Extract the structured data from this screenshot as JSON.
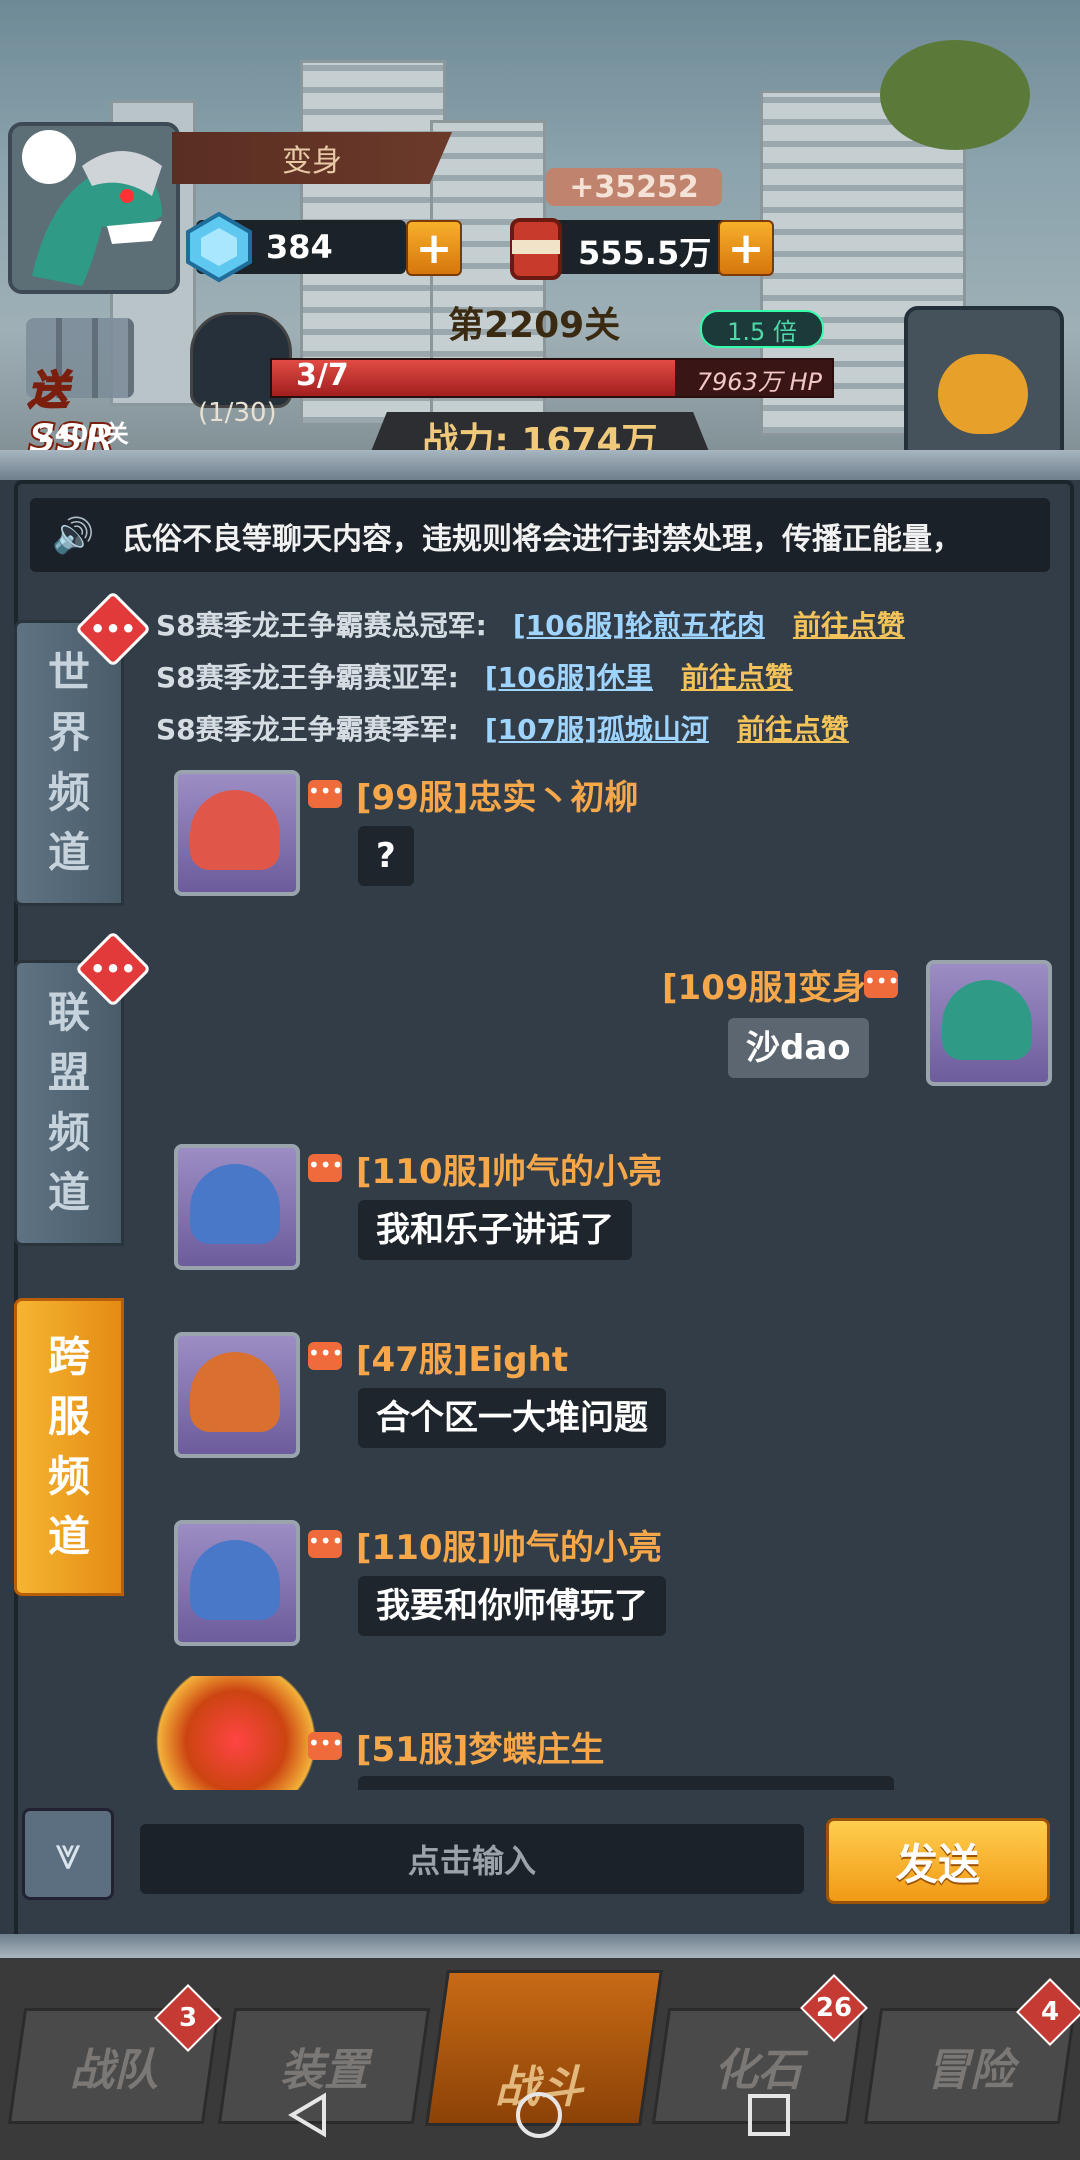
{
  "hud": {
    "player_name": "变身",
    "gems": "384",
    "coins": "555.5万",
    "coin_gain": "+35252",
    "stage": "第2209关",
    "speed": "1.5 倍",
    "boss_progress": "3/7",
    "boss_hp": "7963万 HP",
    "boss_hp_fraction": 0.72,
    "wave": "(1/30)",
    "power": "战力: 1674万",
    "ssr_label": "送SSR",
    "ssr_stage": "2400关"
  },
  "notice": {
    "text": "氐俗不良等聊天内容，违规则将会进行封禁处理，传播正能量，"
  },
  "tabs": [
    {
      "label": [
        "世",
        "界",
        "频",
        "道"
      ],
      "active": false
    },
    {
      "label": [
        "联",
        "盟",
        "频",
        "道"
      ],
      "active": false
    },
    {
      "label": [
        "跨",
        "服",
        "频",
        "道"
      ],
      "active": true
    }
  ],
  "announcements": [
    {
      "title": "S8赛季龙王争霸赛总冠军:",
      "server": "[106服]轮煎五花肉",
      "action": "前往点赞"
    },
    {
      "title": "S8赛季龙王争霸赛亚军:",
      "server": "[106服]休里",
      "action": "前往点赞"
    },
    {
      "title": "S8赛季龙王争霸赛季军:",
      "server": "[107服]孤城山河",
      "action": "前往点赞"
    }
  ],
  "messages": [
    {
      "name": "[99服]忠实丶初柳",
      "text": "?",
      "mine": false
    },
    {
      "name": "[109服]变身",
      "text": "沙dao",
      "mine": true
    },
    {
      "name": "[110服]帅气的小亮",
      "text": "我和乐子讲话了",
      "mine": false
    },
    {
      "name": "[47服]Eight",
      "text": "合个区一大堆问题",
      "mine": false
    },
    {
      "name": "[110服]帅气的小亮",
      "text": "我要和你师傅玩了",
      "mine": false
    },
    {
      "name": "[51服]梦蝶庄生",
      "text": "",
      "mine": false
    }
  ],
  "input": {
    "placeholder": "点击输入",
    "send_label": "发送"
  },
  "bottom_nav": [
    {
      "label": "战队",
      "badge": "3"
    },
    {
      "label": "装置",
      "badge": ""
    },
    {
      "label": "战斗",
      "badge": ""
    },
    {
      "label": "化石",
      "badge": "26"
    },
    {
      "label": "冒险",
      "badge": "4"
    }
  ],
  "colors": {
    "accent_orange": "#f19a16",
    "name_orange": "#f5a74a",
    "link_blue": "#9fd4ff",
    "like_gold": "#f3c35a"
  }
}
